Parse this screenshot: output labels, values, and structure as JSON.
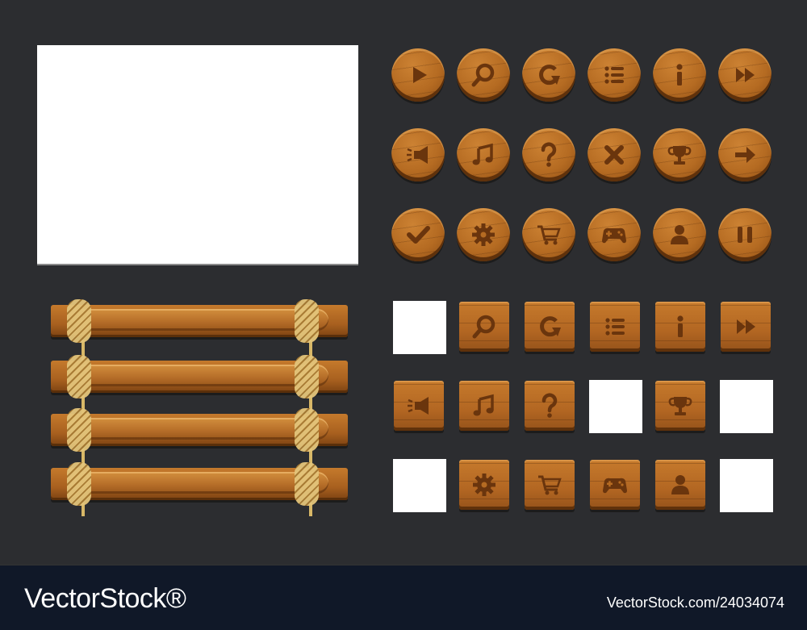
{
  "sheet": {
    "round_buttons": [
      {
        "icon": "play-icon",
        "row": 0,
        "col": 0
      },
      {
        "icon": "magnifier-icon",
        "row": 0,
        "col": 1
      },
      {
        "icon": "restart-arrow-icon",
        "row": 0,
        "col": 2
      },
      {
        "icon": "list-menu-icon",
        "row": 0,
        "col": 3
      },
      {
        "icon": "info-icon",
        "row": 0,
        "col": 4
      },
      {
        "icon": "fast-forward-icon",
        "row": 0,
        "col": 5
      },
      {
        "icon": "sound-speaker-icon",
        "row": 1,
        "col": 0
      },
      {
        "icon": "music-note-icon",
        "row": 1,
        "col": 1
      },
      {
        "icon": "question-mark-icon",
        "row": 1,
        "col": 2
      },
      {
        "icon": "close-x-icon",
        "row": 1,
        "col": 3
      },
      {
        "icon": "trophy-icon",
        "row": 1,
        "col": 4
      },
      {
        "icon": "arrow-right-icon",
        "row": 1,
        "col": 5
      },
      {
        "icon": "checkmark-icon",
        "row": 2,
        "col": 0
      },
      {
        "icon": "gear-icon",
        "row": 2,
        "col": 1
      },
      {
        "icon": "shopping-cart-icon",
        "row": 2,
        "col": 2
      },
      {
        "icon": "gamepad-icon",
        "row": 2,
        "col": 3
      },
      {
        "icon": "user-profile-icon",
        "row": 2,
        "col": 4
      },
      {
        "icon": "pause-icon",
        "row": 2,
        "col": 5
      }
    ],
    "square_buttons": [
      {
        "icon": "blank",
        "row": 0,
        "col": 0
      },
      {
        "icon": "magnifier-icon",
        "row": 0,
        "col": 1
      },
      {
        "icon": "restart-arrow-icon",
        "row": 0,
        "col": 2
      },
      {
        "icon": "list-menu-icon",
        "row": 0,
        "col": 3
      },
      {
        "icon": "info-icon",
        "row": 0,
        "col": 4
      },
      {
        "icon": "fast-forward-icon",
        "row": 0,
        "col": 5
      },
      {
        "icon": "sound-speaker-icon",
        "row": 1,
        "col": 0
      },
      {
        "icon": "music-note-icon",
        "row": 1,
        "col": 1
      },
      {
        "icon": "question-mark-icon",
        "row": 1,
        "col": 2
      },
      {
        "icon": "blank",
        "row": 1,
        "col": 3
      },
      {
        "icon": "trophy-icon",
        "row": 1,
        "col": 4
      },
      {
        "icon": "blank",
        "row": 1,
        "col": 5
      },
      {
        "icon": "blank",
        "row": 2,
        "col": 0
      },
      {
        "icon": "gear-icon",
        "row": 2,
        "col": 1
      },
      {
        "icon": "shopping-cart-icon",
        "row": 2,
        "col": 2
      },
      {
        "icon": "gamepad-icon",
        "row": 2,
        "col": 3
      },
      {
        "icon": "user-profile-icon",
        "row": 2,
        "col": 4
      },
      {
        "icon": "blank",
        "row": 2,
        "col": 5
      }
    ],
    "plank_count": 4
  },
  "colors": {
    "background": "#2c2d30",
    "wood": "#b56b22",
    "wood_dark": "#5f310b",
    "icon_engrave": "#6a350d",
    "rope": "#e3c47a",
    "footer": "#101828"
  },
  "footer": {
    "brand_left": "VectorStock®",
    "brand_right": "VectorStock.com/24034074"
  }
}
